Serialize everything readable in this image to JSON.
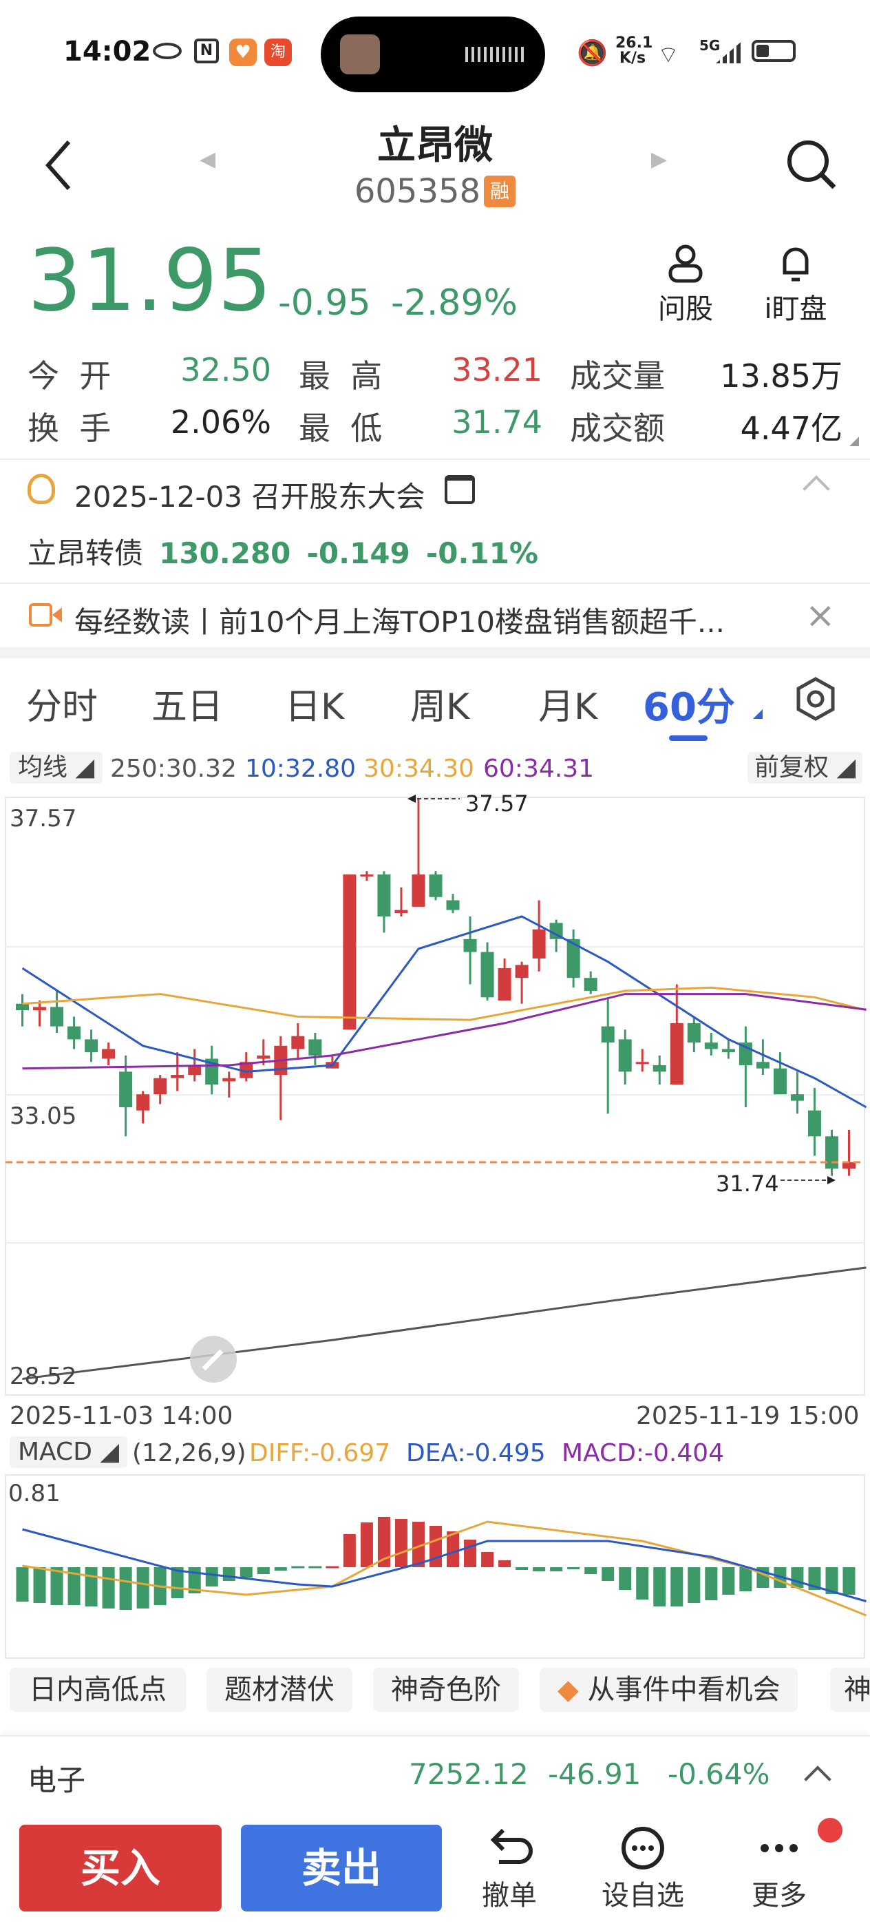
{
  "status": {
    "time": "14:02",
    "net_speed_top": "26.1",
    "net_speed_unit": "K/s",
    "signal": "5G"
  },
  "header": {
    "name": "立昂微",
    "code": "605358",
    "badge": "融"
  },
  "quote": {
    "price": "31.95",
    "change": "-0.95",
    "pct": "-2.89%",
    "ask_label": "问股",
    "watch_label": "i盯盘"
  },
  "stats": {
    "open_label": "今  开",
    "open": "32.50",
    "high_label": "最  高",
    "high": "33.21",
    "vol_label": "成交量",
    "vol": "13.85万",
    "turn_label": "换  手",
    "turn": "2.06%",
    "low_label": "最  低",
    "low": "31.74",
    "amt_label": "成交额",
    "amt": "4.47亿"
  },
  "event": {
    "text": "2025-12-03 召开股东大会"
  },
  "bond": {
    "name": "立昂转债",
    "price": "130.280",
    "change": "-0.149",
    "pct": "-0.11%"
  },
  "news": {
    "text": "每经数读丨前10个月上海TOP10楼盘销售额超千..."
  },
  "tabs": [
    "分时",
    "五日",
    "日K",
    "周K",
    "月K",
    "60分"
  ],
  "active_tab": 5,
  "ma_bar": {
    "label": "均线",
    "ma250": "250:30.32",
    "ma10": "10:32.80",
    "ma30": "30:34.30",
    "ma60": "60:34.31",
    "adjust": "前复权"
  },
  "chart_labels": {
    "top": "37.57",
    "mid": "33.05",
    "bottom": "28.52",
    "hi_mark": "37.57",
    "lo_mark": "31.74",
    "date_start": "2025-11-03 14:00",
    "date_end": "2025-11-19 15:00"
  },
  "macd_bar": {
    "label": "MACD",
    "params": "(12,26,9)",
    "diff": "DIFF:-0.697",
    "dea": "DEA:-0.495",
    "macd": "MACD:-0.404",
    "top": "0.81"
  },
  "chips": [
    "日内高低点",
    "题材潜伏",
    "神奇色阶",
    "从事件中看机会",
    "神"
  ],
  "sector": {
    "name": "电子",
    "price": "7252.12",
    "change": "-46.91",
    "pct": "-0.64%"
  },
  "bottom": {
    "buy": "买入",
    "sell": "卖出",
    "cancel": "撤单",
    "fav": "设自选",
    "more": "更多"
  },
  "colors": {
    "up": "#d23c3c",
    "down": "#3d9a68",
    "ma10": "#2c58c4",
    "ma30": "#e8a63a",
    "ma60": "#8a2ca8",
    "ma250": "#555555",
    "accent": "#3560dc"
  },
  "chart_data": {
    "type": "candlestick",
    "title": "",
    "ylim": [
      28.52,
      37.57
    ],
    "y_ticks": [
      37.57,
      33.05,
      28.52
    ],
    "x_range": [
      "2025-11-03 14:00",
      "2025-11-19 15:00"
    ],
    "candles": [
      [
        34.4,
        34.55,
        34.05,
        34.3
      ],
      [
        34.3,
        34.45,
        34.05,
        34.35
      ],
      [
        34.35,
        34.6,
        33.95,
        34.05
      ],
      [
        34.05,
        34.2,
        33.7,
        33.85
      ],
      [
        33.85,
        34.0,
        33.5,
        33.65
      ],
      [
        33.55,
        33.8,
        33.45,
        33.7
      ],
      [
        33.35,
        33.6,
        32.35,
        32.8
      ],
      [
        32.75,
        33.05,
        32.55,
        33.0
      ],
      [
        33.0,
        33.3,
        32.85,
        33.25
      ],
      [
        33.25,
        33.65,
        33.05,
        33.3
      ],
      [
        33.3,
        33.7,
        33.2,
        33.45
      ],
      [
        33.55,
        33.75,
        33.0,
        33.15
      ],
      [
        33.2,
        33.35,
        32.95,
        33.25
      ],
      [
        33.25,
        33.65,
        33.2,
        33.5
      ],
      [
        33.55,
        33.85,
        33.45,
        33.6
      ],
      [
        33.3,
        33.9,
        32.6,
        33.75
      ],
      [
        33.7,
        34.1,
        33.55,
        33.9
      ],
      [
        33.85,
        33.95,
        33.45,
        33.6
      ],
      [
        33.4,
        33.6,
        33.4,
        33.5
      ],
      [
        34.0,
        36.4,
        34.0,
        36.4
      ],
      [
        36.4,
        36.45,
        36.3,
        36.4
      ],
      [
        36.4,
        36.45,
        35.5,
        35.75
      ],
      [
        35.8,
        36.2,
        35.75,
        35.85
      ],
      [
        35.9,
        37.57,
        35.9,
        36.4
      ],
      [
        36.4,
        36.45,
        36.0,
        36.05
      ],
      [
        36.0,
        36.1,
        35.8,
        35.85
      ],
      [
        35.4,
        35.75,
        34.7,
        35.2
      ],
      [
        35.2,
        35.35,
        34.45,
        34.5
      ],
      [
        34.45,
        35.1,
        34.45,
        34.95
      ],
      [
        34.8,
        35.05,
        34.4,
        35.0
      ],
      [
        35.1,
        36.0,
        34.9,
        35.55
      ],
      [
        35.65,
        35.7,
        35.2,
        35.4
      ],
      [
        35.4,
        35.55,
        34.65,
        34.8
      ],
      [
        34.8,
        34.9,
        34.55,
        34.6
      ],
      [
        34.05,
        34.5,
        32.7,
        33.8
      ],
      [
        33.85,
        34.0,
        33.15,
        33.35
      ],
      [
        33.5,
        33.7,
        33.35,
        33.5
      ],
      [
        33.45,
        33.6,
        33.15,
        33.35
      ],
      [
        33.15,
        34.7,
        33.15,
        34.1
      ],
      [
        34.1,
        34.2,
        33.65,
        33.8
      ],
      [
        33.8,
        33.95,
        33.6,
        33.7
      ],
      [
        33.7,
        33.85,
        33.55,
        33.65
      ],
      [
        33.8,
        34.05,
        32.8,
        33.45
      ],
      [
        33.5,
        33.85,
        33.3,
        33.4
      ],
      [
        33.4,
        33.65,
        33.0,
        33.0
      ],
      [
        33.0,
        33.35,
        32.7,
        32.9
      ],
      [
        32.75,
        33.1,
        32.05,
        32.35
      ],
      [
        32.35,
        32.45,
        31.74,
        31.85
      ],
      [
        31.85,
        32.45,
        31.74,
        31.95
      ]
    ],
    "series": [
      {
        "name": "10",
        "values": [
          [
            0,
            34.95
          ],
          [
            7,
            33.75
          ],
          [
            13,
            33.35
          ],
          [
            18,
            33.45
          ],
          [
            23,
            35.25
          ],
          [
            29,
            35.75
          ],
          [
            34,
            35.05
          ],
          [
            41,
            33.85
          ],
          [
            46,
            33.25
          ],
          [
            49,
            32.8
          ]
        ]
      },
      {
        "name": "30",
        "values": [
          [
            0,
            34.4
          ],
          [
            8,
            34.55
          ],
          [
            16,
            34.2
          ],
          [
            26,
            34.15
          ],
          [
            35,
            34.6
          ],
          [
            40,
            34.65
          ],
          [
            46,
            34.5
          ],
          [
            49,
            34.3
          ]
        ]
      },
      {
        "name": "60",
        "values": [
          [
            0,
            33.4
          ],
          [
            12,
            33.45
          ],
          [
            18,
            33.6
          ],
          [
            28,
            34.1
          ],
          [
            35,
            34.55
          ],
          [
            42,
            34.55
          ],
          [
            49,
            34.31
          ]
        ]
      },
      {
        "name": "250",
        "values": [
          [
            0,
            28.6
          ],
          [
            18,
            29.2
          ],
          [
            34,
            29.8
          ],
          [
            49,
            30.32
          ]
        ]
      }
    ],
    "macd": {
      "histogram": [
        -0.5,
        -0.52,
        -0.55,
        -0.55,
        -0.57,
        -0.6,
        -0.62,
        -0.6,
        -0.55,
        -0.45,
        -0.38,
        -0.28,
        -0.2,
        -0.15,
        -0.1,
        -0.05,
        -0.02,
        -0.01,
        0.01,
        0.48,
        0.65,
        0.73,
        0.7,
        0.66,
        0.6,
        0.52,
        0.4,
        0.22,
        0.1,
        -0.04,
        -0.06,
        -0.06,
        -0.03,
        -0.1,
        -0.2,
        -0.33,
        -0.47,
        -0.57,
        -0.57,
        -0.52,
        -0.48,
        -0.4,
        -0.35,
        -0.3,
        -0.3,
        -0.3,
        -0.33,
        -0.39,
        -0.4
      ],
      "diff": [
        [
          0,
          0.02
        ],
        [
          8,
          -0.28
        ],
        [
          13,
          -0.4
        ],
        [
          18,
          -0.28
        ],
        [
          21,
          0.12
        ],
        [
          27,
          0.66
        ],
        [
          36,
          0.38
        ],
        [
          42,
          0.0
        ],
        [
          49,
          -0.7
        ]
      ],
      "dea": [
        [
          0,
          0.55
        ],
        [
          9,
          -0.05
        ],
        [
          16,
          -0.25
        ],
        [
          18,
          -0.28
        ],
        [
          23,
          0.05
        ],
        [
          27,
          0.38
        ],
        [
          34,
          0.38
        ],
        [
          40,
          0.15
        ],
        [
          49,
          -0.495
        ]
      ]
    }
  }
}
